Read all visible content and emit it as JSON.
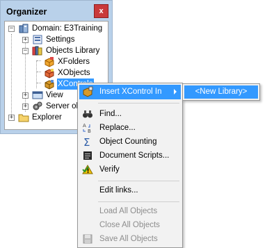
{
  "organizer": {
    "title": "Organizer",
    "close_label": "x",
    "tree": {
      "domain": "Domain: E3Training",
      "settings": "Settings",
      "objects_library": "Objects Library",
      "xfolders": "XFolders",
      "xobjects": "XObjects",
      "xcontrols": "XControls",
      "view": "View",
      "server": "Server ob",
      "explorer": "Explorer"
    }
  },
  "context_menu": {
    "insert_xcontrol": "Insert XControl In",
    "find": "Find...",
    "replace": "Replace...",
    "object_counting": "Object Counting",
    "document_scripts": "Document Scripts...",
    "verify": "Verify",
    "edit_links": "Edit links...",
    "load_all": "Load All Objects",
    "close_all": "Close All Objects",
    "save_all": "Save All Objects"
  },
  "submenu": {
    "new_library": "<New Library>"
  },
  "colors": {
    "highlight": "#3399ff",
    "panel": "#b9d1ea",
    "close_button": "#c9393a",
    "disabled_text": "#8d8d8d"
  }
}
